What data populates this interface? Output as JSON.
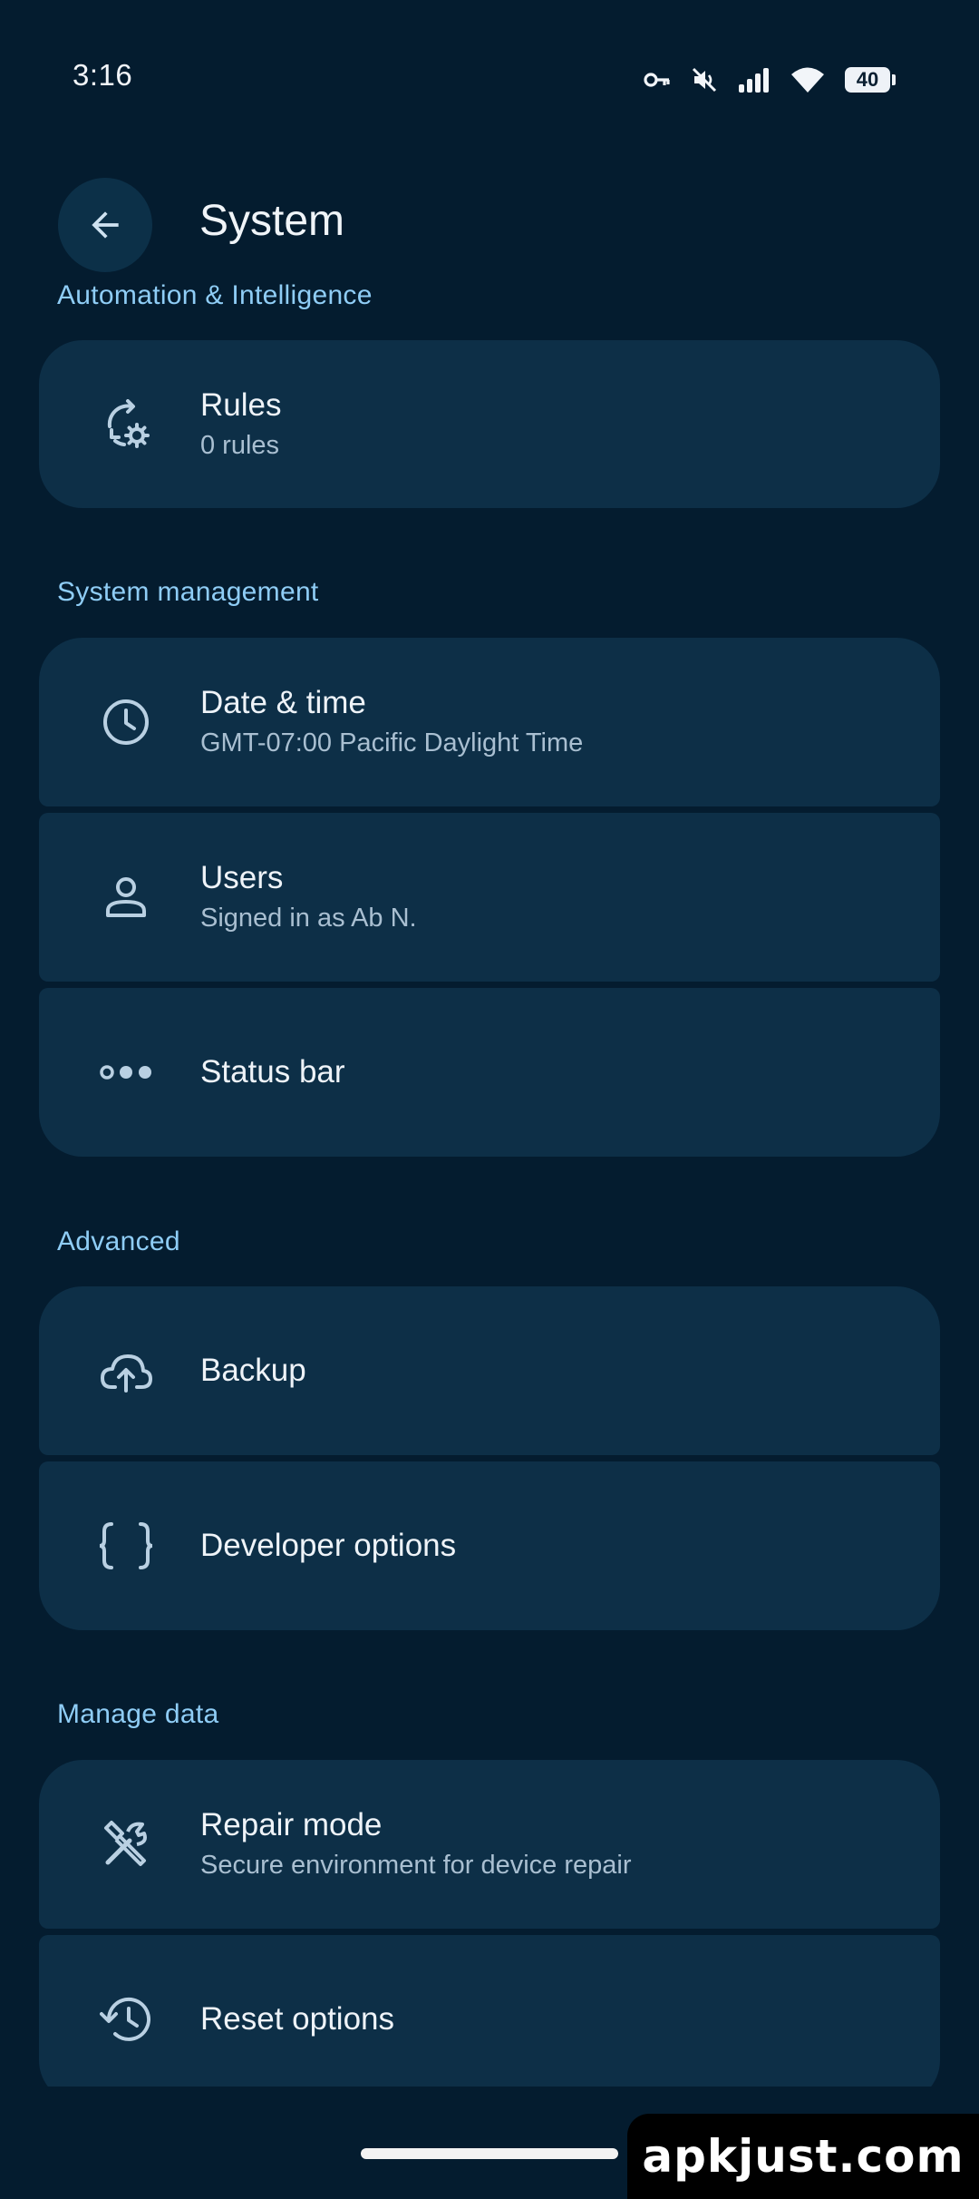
{
  "status_bar": {
    "time": "3:16",
    "battery": "40",
    "icons": [
      "vpn-key-icon",
      "muted-icon",
      "signal-icon",
      "wifi-icon",
      "battery-icon"
    ]
  },
  "app_bar": {
    "title": "System",
    "back_icon": "arrow-back-icon"
  },
  "sections": {
    "automation": {
      "header": "Automation & Intelligence",
      "items": [
        {
          "title": "Rules",
          "subtitle": "0 rules",
          "icon": "rules-sync-gear-icon"
        }
      ]
    },
    "system_management": {
      "header": "System management",
      "items": [
        {
          "title": "Date & time",
          "subtitle": "GMT-07:00 Pacific Daylight Time",
          "icon": "clock-icon"
        },
        {
          "title": "Users",
          "subtitle": "Signed in as Ab N.",
          "icon": "person-icon"
        },
        {
          "title": "Status bar",
          "icon": "dots-icon"
        }
      ]
    },
    "advanced": {
      "header": "Advanced",
      "items": [
        {
          "title": "Backup",
          "icon": "cloud-upload-icon"
        },
        {
          "title": "Developer options",
          "icon": "braces-icon"
        }
      ]
    },
    "manage_data": {
      "header": "Manage data",
      "items": [
        {
          "title": "Repair mode",
          "subtitle": "Secure environment for device repair",
          "icon": "tools-icon"
        },
        {
          "title": "Reset options",
          "icon": "history-icon"
        }
      ]
    }
  },
  "watermark": "apkjust.com",
  "colors": {
    "background": "#041c2f",
    "card": "#0d2f47",
    "accent": "#8fcdf6",
    "icon": "#b9d0e2"
  }
}
